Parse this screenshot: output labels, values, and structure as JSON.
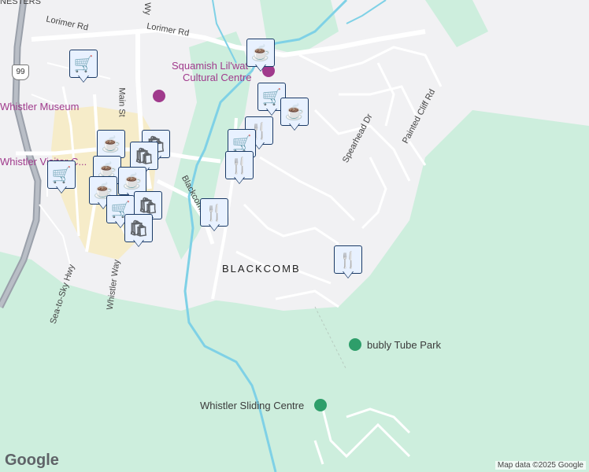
{
  "labels": {
    "nesters": "NESTERS",
    "lorimer_rd_1": "Lorimer Rd",
    "lorimer_rd_2": "Lorimer Rd",
    "squamish_line1": "Squamish Lil'wat",
    "squamish_line2": "Cultural Centre",
    "whistler_museum": "Whistler Museum",
    "main_st": "Main St",
    "whistler_visitor": "Whistler Visitor C...",
    "spearhead_dr": "Spearhead Dr",
    "painted_cliff_rd": "Painted Cliff Rd",
    "blackcomb_wy_1": "Blackcomb Wy",
    "blackcomb_wy_2": "mb Wy",
    "blackcomb_area": "BLACKCOMB",
    "sea_to_sky": "Sea-to-Sky Hwy",
    "whistler_way": "Whistler Way",
    "tube_park": "bubly Tube Park",
    "sliding_centre": "Whistler Sliding Centre",
    "route_99": "99",
    "partial_er": "er"
  },
  "markers": [
    {
      "type": "coffee-icon",
      "glyph": "☕"
    },
    {
      "type": "shopping-cart-icon",
      "glyph": "🛒"
    },
    {
      "type": "shopping-cart-icon",
      "glyph": "🛒"
    },
    {
      "type": "coffee-icon",
      "glyph": "☕"
    },
    {
      "type": "restaurant-icon",
      "glyph": "🍴"
    },
    {
      "type": "shopping-cart-icon",
      "glyph": "🛒"
    },
    {
      "type": "restaurant-icon",
      "glyph": "🍴"
    },
    {
      "type": "restaurant-icon",
      "glyph": "🍴"
    },
    {
      "type": "restaurant-icon",
      "glyph": "🍴"
    },
    {
      "type": "coffee-icon",
      "glyph": "☕"
    },
    {
      "type": "shopping-bag-icon",
      "glyph": "🛍"
    },
    {
      "type": "shopping-bag-icon",
      "glyph": "🛍"
    },
    {
      "type": "shopping-cart-icon",
      "glyph": "🛒"
    },
    {
      "type": "coffee-icon",
      "glyph": "☕"
    },
    {
      "type": "coffee-icon",
      "glyph": "☕"
    },
    {
      "type": "coffee-icon",
      "glyph": "☕"
    },
    {
      "type": "shopping-cart-icon",
      "glyph": "🛒"
    },
    {
      "type": "shopping-bag-icon",
      "glyph": "🛍"
    },
    {
      "type": "shopping-bag-icon",
      "glyph": "🛍"
    }
  ],
  "colors": {
    "forest": "#cdeedd",
    "urban": "#f1f1f3",
    "village": "#f6ecc9",
    "water": "#7fd1e6",
    "road": "#ffffff",
    "highway": "#9aa0aa",
    "marker_fill": "#e8f1ff",
    "marker_border": "#1a3a66",
    "marker_icon": "#1a3a66"
  },
  "google_logo": "Google",
  "attribution": "Map data ©2025 Google"
}
